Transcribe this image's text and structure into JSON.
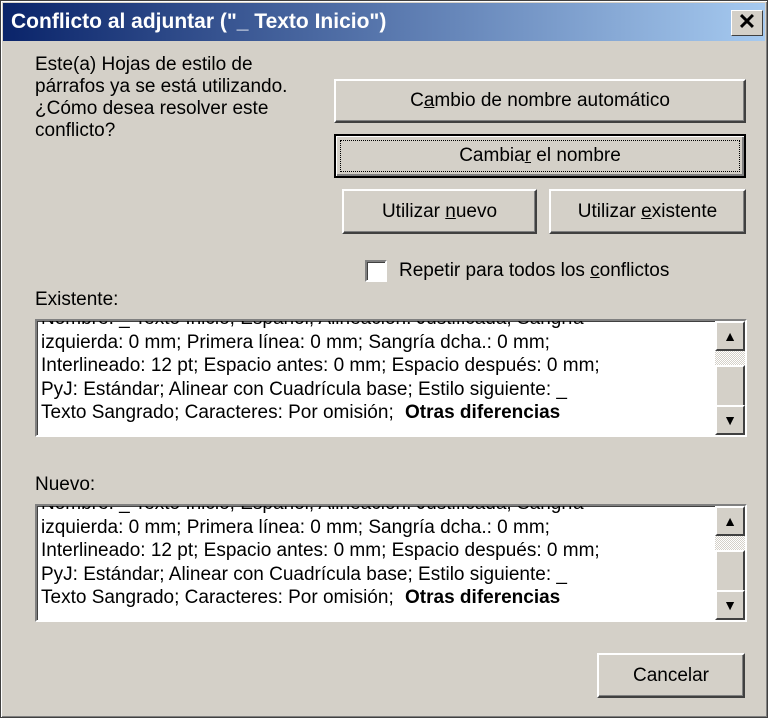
{
  "window": {
    "title": "Conflicto al adjuntar (\"_ Texto Inicio\")",
    "close_glyph": "✕"
  },
  "message": {
    "lines": [
      "Este(a) Hojas de estilo de",
      "párrafos ya se está utilizando.",
      "¿Cómo desea  resolver este",
      "conflicto?"
    ]
  },
  "buttons": {
    "auto_rename": {
      "pre": "C",
      "key": "a",
      "post": "mbio de nombre automático"
    },
    "rename": {
      "pre": "Cambia",
      "key": "r",
      "post": " el nombre"
    },
    "use_new": {
      "pre": "Utilizar ",
      "key": "n",
      "post": "uevo"
    },
    "use_existing": {
      "pre": "Utilizar ",
      "key": "e",
      "post": "xistente"
    },
    "cancel": "Cancelar"
  },
  "repeat_checkbox": {
    "checked": false,
    "pre": "Repetir para todos los ",
    "key": "c",
    "post": "onflictos"
  },
  "existing": {
    "label": "Existente:",
    "lines": [
      "Nombre: _ Texto Inicio;   Español;   Alineación: Justificada;   Sangría",
      "izquierda: 0 mm;  Primera línea: 0 mm;  Sangría dcha.: 0 mm;",
      "Interlineado: 12 pt;  Espacio antes: 0 mm;  Espacio después: 0 mm;",
      "PyJ: Estándar;  Alinear con Cuadrícula base;  Estilo siguiente: _",
      "Texto Sangrado;  Caracteres: Por omisión;"
    ],
    "bold_suffix": "Otras diferencias"
  },
  "new": {
    "label": "Nuevo:",
    "lines": [
      "Nombre: _ Texto Inicio;   Español;   Alineación: Justificada;   Sangría",
      "izquierda: 0 mm;  Primera línea: 0 mm;  Sangría dcha.: 0 mm;",
      "Interlineado: 12 pt;  Espacio antes: 0 mm;  Espacio después: 0 mm;",
      "PyJ: Estándar;  Alinear con Cuadrícula base;  Estilo siguiente: _",
      "Texto Sangrado;  Caracteres: Por omisión;"
    ],
    "bold_suffix": "Otras diferencias"
  },
  "scroll_glyphs": {
    "up": "▲",
    "down": "▼"
  }
}
